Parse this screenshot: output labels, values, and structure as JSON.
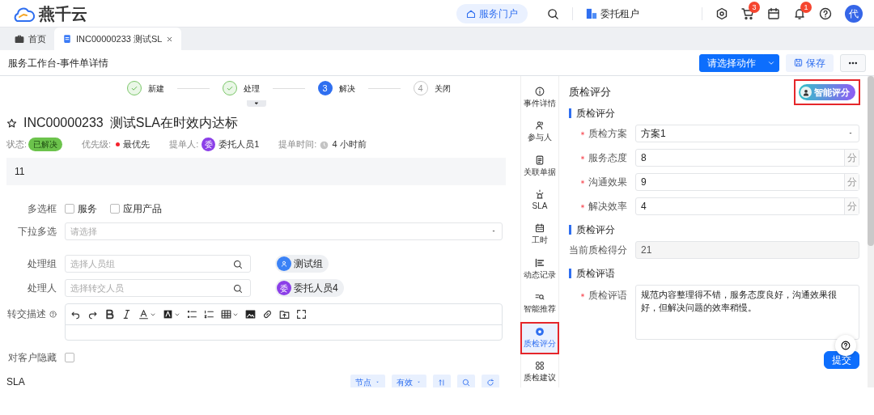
{
  "header": {
    "logo_text": "燕千云",
    "portal_button": "服务门户",
    "tenant": "委托租户",
    "cart_badge": "3",
    "bell_badge": "1",
    "avatar": "代"
  },
  "tabs": [
    {
      "label": "首页",
      "selected": false,
      "closable": false
    },
    {
      "label": "INC00000233 测试SL",
      "selected": true,
      "closable": true
    }
  ],
  "page_title": "服务工作台-事件单详情",
  "toolbar": {
    "action_button": "请选择动作",
    "save_button": "保存"
  },
  "steps": [
    {
      "label": "新建",
      "done": true
    },
    {
      "label": "处理",
      "done": true
    },
    {
      "number": "3",
      "label": "解决",
      "done": false,
      "current": true
    },
    {
      "number": "4",
      "label": "关闭",
      "done": false,
      "current": false
    }
  ],
  "ticket": {
    "starred": false,
    "id": "INC00000233",
    "title": "测试SLA在时效内达标",
    "status_label": "状态:",
    "status": "已解决",
    "priority_label": "优先级:",
    "priority": "最优先",
    "submitter_label": "提单人:",
    "submitter_avatar": "委",
    "submitter": "委托人员1",
    "time_label": "提单时间:",
    "time": "4 小时前",
    "description": "11"
  },
  "form": [
    {
      "kind": "checkboxes",
      "label": "多选框",
      "options": [
        {
          "label": "服务",
          "checked": false
        },
        {
          "label": "应用产品",
          "checked": false
        }
      ]
    },
    {
      "kind": "select",
      "label": "下拉多选",
      "placeholder": "请选择"
    },
    {
      "kind": "search",
      "label": "处理组",
      "placeholder": "选择人员组",
      "tag": "测试组"
    },
    {
      "kind": "search",
      "label": "处理人",
      "placeholder": "选择转交人员",
      "tag": "委托人员4",
      "tag_avatar": "委"
    },
    {
      "kind": "editor",
      "label": "转交描述"
    },
    {
      "kind": "checkbox",
      "label": "对客户隐藏",
      "checked": false
    }
  ],
  "sla": {
    "title": "SLA",
    "buttons": [
      "节点",
      "有效"
    ]
  },
  "side_nav": [
    {
      "label": "事件详情",
      "selected": false,
      "highlighted": false
    },
    {
      "label": "参与人",
      "selected": false,
      "highlighted": false
    },
    {
      "label": "关联单据",
      "selected": false,
      "highlighted": false
    },
    {
      "label": "SLA",
      "selected": false,
      "highlighted": false
    },
    {
      "label": "工时",
      "selected": false,
      "highlighted": false
    },
    {
      "label": "动态记录",
      "selected": false,
      "highlighted": false
    },
    {
      "label": "智能推荐",
      "selected": false,
      "highlighted": false
    },
    {
      "label": "质检评分",
      "selected": true,
      "highlighted": true
    },
    {
      "label": "质检建议",
      "selected": false,
      "highlighted": false
    }
  ],
  "panel": {
    "title": "质检评分",
    "ai_button": "智能评分",
    "ai_highlighted": true,
    "sections": [
      {
        "title": "质检评分",
        "fields": [
          {
            "kind": "select",
            "label": "质检方案",
            "required": true,
            "value": "方案1"
          },
          {
            "kind": "number",
            "label": "服务态度",
            "required": true,
            "value": "8",
            "suffix": "分"
          },
          {
            "kind": "number",
            "label": "沟通效果",
            "required": true,
            "value": "9",
            "suffix": "分"
          },
          {
            "kind": "number",
            "label": "解决效率",
            "required": true,
            "value": "4",
            "suffix": "分"
          }
        ]
      },
      {
        "title": "质检评分",
        "fields": [
          {
            "kind": "readonly",
            "label": "当前质检得分",
            "required": false,
            "value": "21"
          }
        ]
      },
      {
        "title": "质检评语",
        "fields": [
          {
            "kind": "textarea",
            "label": "质检评语",
            "required": true,
            "value": "规范内容整理得不错，服务态度良好，沟通效果很好，但解决问题的效率稍慢。"
          }
        ]
      }
    ],
    "submit": "提交"
  }
}
